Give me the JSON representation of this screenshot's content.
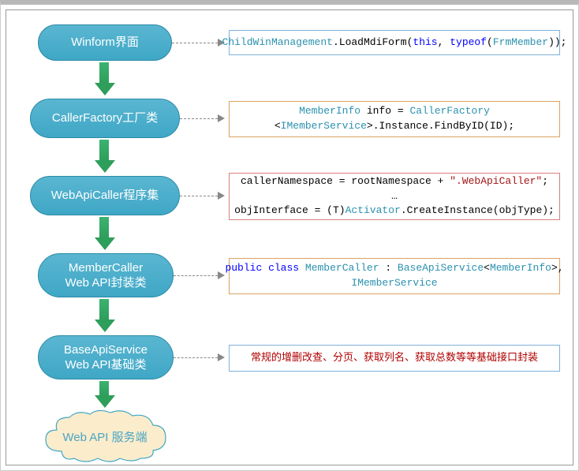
{
  "nodes": {
    "n1": "Winform界面",
    "n2": "CallerFactory工厂类",
    "n3": "WebApiCaller程序集",
    "n4a": "MemberCaller",
    "n4b": "Web API封装类",
    "n5a": "BaseApiService",
    "n5b": "Web API基础类",
    "cloud": "Web API 服务端"
  },
  "code": {
    "c1": {
      "tokens": [
        {
          "t": "ChildWinManagement",
          "c": "tk-type"
        },
        {
          "t": ".LoadMdiForm(",
          "c": "tk-plain"
        },
        {
          "t": "this",
          "c": "tk-kw"
        },
        {
          "t": ", ",
          "c": "tk-plain"
        },
        {
          "t": "typeof",
          "c": "tk-kw"
        },
        {
          "t": "(",
          "c": "tk-plain"
        },
        {
          "t": "FrmMember",
          "c": "tk-type"
        },
        {
          "t": "));",
          "c": "tk-plain"
        }
      ]
    },
    "c2": {
      "line1": [
        {
          "t": "MemberInfo",
          "c": "tk-type"
        },
        {
          "t": " info = ",
          "c": "tk-plain"
        },
        {
          "t": "CallerFactory",
          "c": "tk-type"
        }
      ],
      "line2": [
        {
          "t": "<",
          "c": "tk-plain"
        },
        {
          "t": "IMemberService",
          "c": "tk-type"
        },
        {
          "t": ">.Instance.FindByID(ID);",
          "c": "tk-plain"
        }
      ]
    },
    "c3": {
      "line1": [
        {
          "t": "callerNamespace = rootNamespace + ",
          "c": "tk-plain"
        },
        {
          "t": "\".WebApiCaller\"",
          "c": "tk-str"
        },
        {
          "t": ";",
          "c": "tk-plain"
        }
      ],
      "dots": "…",
      "line2": [
        {
          "t": "objInterface = (T)",
          "c": "tk-plain"
        },
        {
          "t": "Activator",
          "c": "tk-type"
        },
        {
          "t": ".CreateInstance(objType);",
          "c": "tk-plain"
        }
      ]
    },
    "c4": {
      "line1": [
        {
          "t": "public",
          "c": "tk-kw"
        },
        {
          "t": " ",
          "c": "tk-plain"
        },
        {
          "t": "class",
          "c": "tk-kw"
        },
        {
          "t": " ",
          "c": "tk-plain"
        },
        {
          "t": "MemberCaller",
          "c": "tk-type"
        },
        {
          "t": " : ",
          "c": "tk-plain"
        },
        {
          "t": "BaseApiService",
          "c": "tk-type"
        },
        {
          "t": "<",
          "c": "tk-plain"
        },
        {
          "t": "MemberInfo",
          "c": "tk-type"
        },
        {
          "t": ">,",
          "c": "tk-plain"
        }
      ],
      "line2": [
        {
          "t": "IMemberService",
          "c": "tk-type"
        }
      ]
    },
    "c5": {
      "line1": [
        {
          "t": "常规的增删改查、分页、获取列名、获取总数等等基础接口封装",
          "c": "tk-red"
        }
      ]
    }
  }
}
